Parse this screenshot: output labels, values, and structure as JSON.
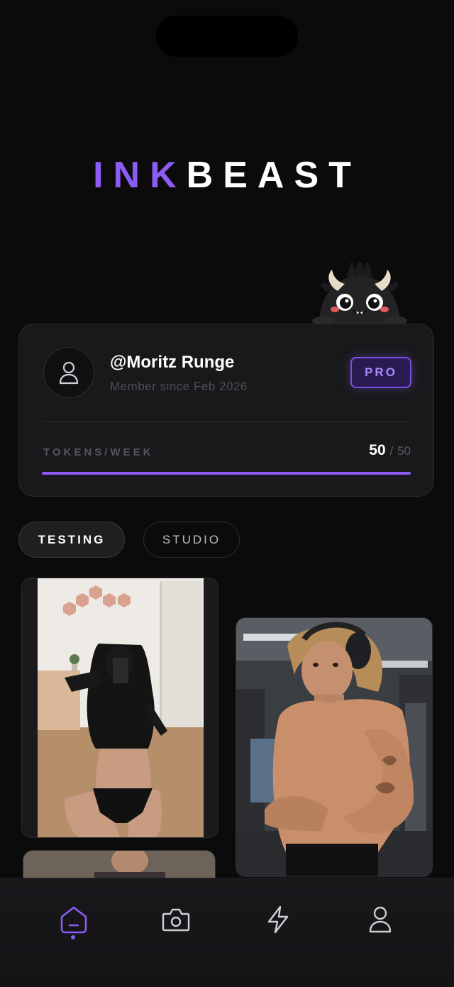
{
  "app": {
    "logo_part1": "INK",
    "logo_part2": "BEAST"
  },
  "profile": {
    "username": "@Moritz Runge",
    "member_since": "Member since Feb 2026",
    "plan_badge": "PRO",
    "tokens_label": "TOKENS/WEEK",
    "tokens_used": "50",
    "tokens_separator": "/",
    "tokens_max": "50",
    "tokens_fraction": 1.0
  },
  "tabs": [
    {
      "label": "TESTING",
      "active": true
    },
    {
      "label": "STUDIO",
      "active": false
    }
  ],
  "gallery": [
    {
      "subject": "mirror selfie photo"
    },
    {
      "subject": "gym flex photo with headphones"
    },
    {
      "subject": "partial photo"
    }
  ],
  "bottom_nav": [
    {
      "icon": "home-icon",
      "active": true
    },
    {
      "icon": "camera-icon",
      "active": false
    },
    {
      "icon": "lightning-icon",
      "active": false
    },
    {
      "icon": "user-icon",
      "active": false
    }
  ],
  "colors": {
    "accent": "#8b5cf6",
    "background": "#0b0b0c",
    "card": "#19191b"
  }
}
